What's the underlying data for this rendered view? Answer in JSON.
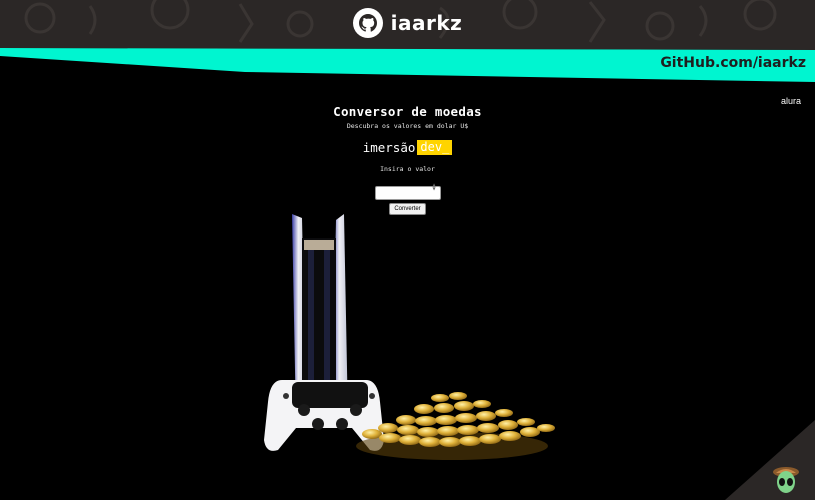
{
  "banner": {
    "username": "iaarkz",
    "github_link": "GitHub.com/iaarkz",
    "icons": [
      "github-icon",
      "avatar-icon"
    ]
  },
  "site": {
    "alura_logo": "alura",
    "title": "Conversor de moedas",
    "subtitle": "Descubra os valores em dolar U$",
    "logo_part1": "imersão",
    "logo_part2": "dev_",
    "input_label": "Insira o valor",
    "input_value": "",
    "button_label": "Converter"
  },
  "colors": {
    "banner_bg": "#2b2726",
    "accent_teal": "#00f5d0",
    "logo_yellow": "#ffd400",
    "page_bg": "#000000"
  }
}
